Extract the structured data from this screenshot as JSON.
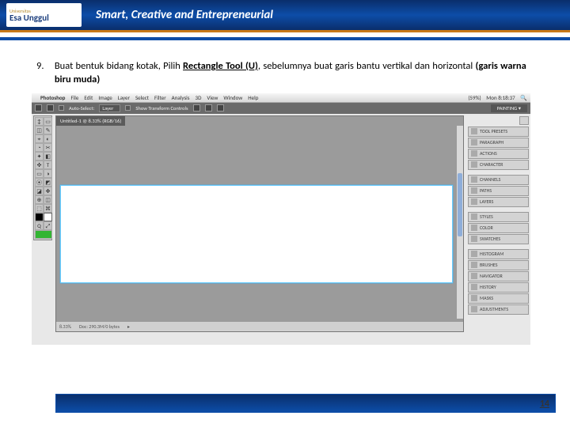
{
  "header": {
    "logo_small": "Universitas",
    "logo_name": "Esa Unggul",
    "tagline": "Smart, Creative and Entrepreneurial"
  },
  "instruction": {
    "number": "9.",
    "pre": "Buat bentuk bidang kotak, Pilih ",
    "tool": "Rectangle Tool (U)",
    "post1": ", sebelumnya buat garis bantu vertikal dan horizontal ",
    "post2": "(garis warna biru muda)"
  },
  "mac_menu": {
    "apple": "",
    "app": "Photoshop",
    "items": [
      "File",
      "Edit",
      "Image",
      "Layer",
      "Select",
      "Filter",
      "Analysis",
      "3D",
      "View",
      "Window",
      "Help"
    ],
    "right": {
      "pct": "(59%)",
      "time": "Mon 8:18:37"
    }
  },
  "options": {
    "auto_select": "Auto-Select:",
    "layer": "Layer",
    "show_transform": "Show Transform Controls",
    "workspace": "PAINTING ▾"
  },
  "canvas": {
    "tab": "Untitled-1 @ 8.33% (RGB/16)",
    "zoom": "8.33%",
    "docinfo": "Doc: 290.3M/0 bytes"
  },
  "panels": [
    "TOOL PRESETS",
    "PARAGRAPH",
    "ACTIONS",
    "CHARACTER",
    "CHANNELS",
    "PATHS",
    "LAYERS",
    "STYLES",
    "COLOR",
    "SWATCHES",
    "HISTOGRAM",
    "BRUSHES",
    "NAVIGATOR",
    "HISTORY",
    "MASKS",
    "ADJUSTMENTS"
  ],
  "tools_glyphs": [
    "↕",
    "▭",
    "◫",
    "✎",
    "⌖",
    "◐",
    "◔",
    "✂",
    "✦",
    "◧",
    "✜",
    "T",
    "▭",
    "◑",
    "⦿",
    "◩",
    "◪",
    "✥",
    "⊕",
    "◫",
    "⬚",
    "⌘",
    "Q",
    "⤢"
  ],
  "page": "14"
}
